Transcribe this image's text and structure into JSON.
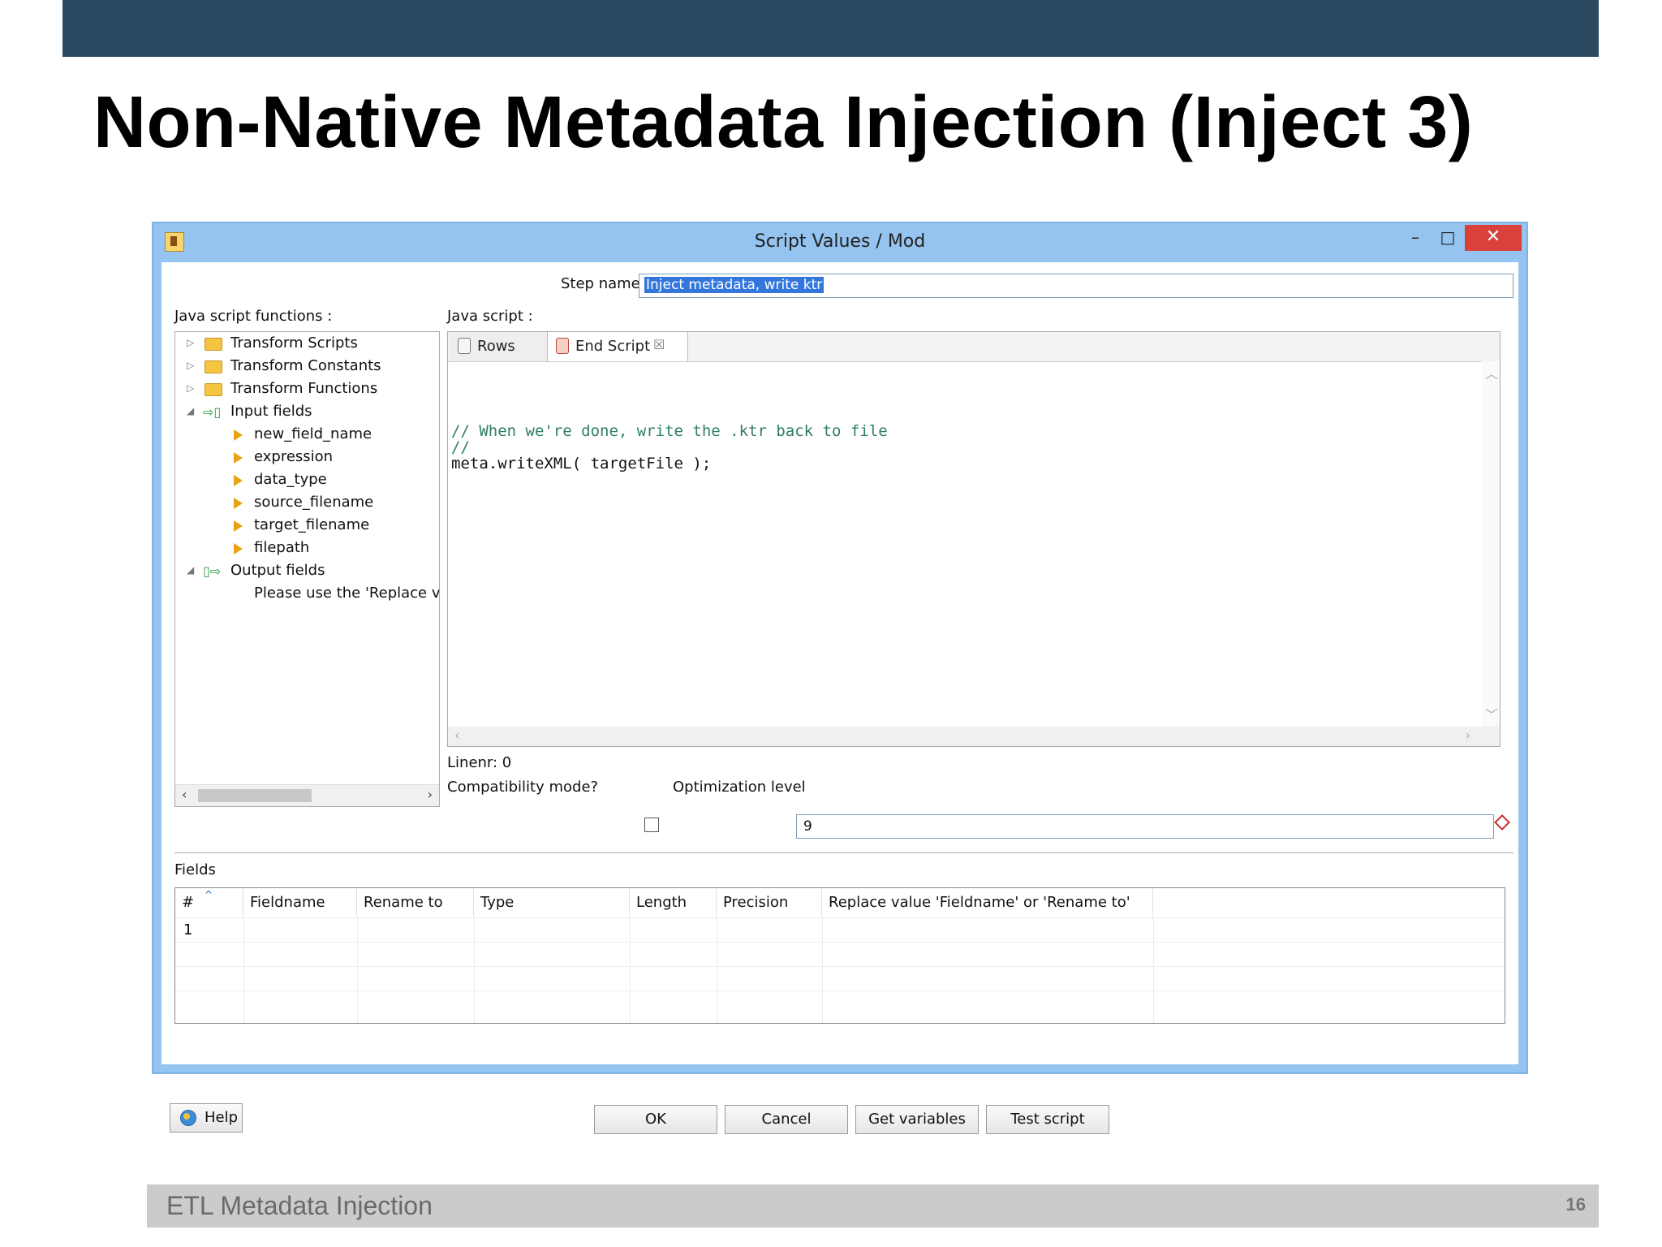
{
  "slide": {
    "title": "Non-Native Metadata Injection (Inject 3)",
    "footer_text": "ETL Metadata Injection",
    "page_number": "16"
  },
  "dialog": {
    "title": "Script Values / Mod",
    "minimize_glyph": "–",
    "maximize_glyph": "□",
    "close_glyph": "✕",
    "step_name_label": "Step name",
    "step_name_value": "Inject metadata, write ktr",
    "functions_label": "Java script functions :",
    "script_label": "Java script :",
    "tree": {
      "items": [
        {
          "label": "Transform Scripts",
          "icon": "folder-icon",
          "expander": "▷"
        },
        {
          "label": "Transform Constants",
          "icon": "folder-icon",
          "expander": "▷"
        },
        {
          "label": "Transform Functions",
          "icon": "folder-icon",
          "expander": "▷"
        },
        {
          "label": "Input fields",
          "icon": "input-fields-icon",
          "expander": "◢"
        },
        {
          "label": "new_field_name",
          "icon": "field-arrow-icon"
        },
        {
          "label": "expression",
          "icon": "field-arrow-icon"
        },
        {
          "label": "data_type",
          "icon": "field-arrow-icon"
        },
        {
          "label": "source_filename",
          "icon": "field-arrow-icon"
        },
        {
          "label": "target_filename",
          "icon": "field-arrow-icon"
        },
        {
          "label": "filepath",
          "icon": "field-arrow-icon"
        },
        {
          "label": "Output fields",
          "icon": "output-fields-icon",
          "expander": "◢"
        },
        {
          "label": "Please use the 'Replace valu"
        }
      ],
      "scroll_left": "‹",
      "scroll_right": "›"
    },
    "tabs": [
      {
        "label": "Rows"
      },
      {
        "label": "End Script",
        "close": "☒"
      }
    ],
    "code": {
      "line1": "// When we're done, write the .ktr back to file",
      "line2": "//",
      "line3": "meta.writeXML( targetFile );"
    },
    "scroll_glyphs": {
      "up": "︿",
      "down": "﹀",
      "left": "‹",
      "right": "›"
    },
    "linenr_label": "Linenr: 0",
    "compat_label": "Compatibility mode?",
    "optimization_label": "Optimization level",
    "optimization_value": "9",
    "fields_label": "Fields",
    "grid": {
      "sort_glyph": "^",
      "headers": [
        "#",
        "Fieldname",
        "Rename to",
        "Type",
        "Length",
        "Precision",
        "Replace value 'Fieldname' or 'Rename to'"
      ],
      "rows": [
        [
          "1",
          "",
          "",
          "",
          "",
          "",
          ""
        ]
      ]
    },
    "buttons": {
      "help": "Help",
      "ok": "OK",
      "cancel": "Cancel",
      "get_variables": "Get variables",
      "test_script": "Test script"
    }
  }
}
